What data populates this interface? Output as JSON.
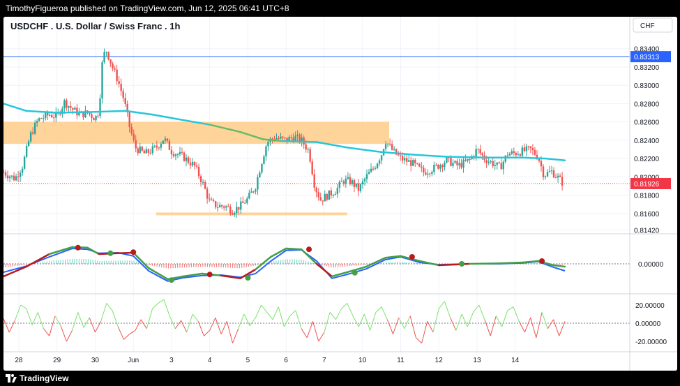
{
  "header": {
    "publisher_text": "TimothyFigueroa published on TradingView.com, Jun 12, 2025 06:41 UTC+8"
  },
  "footer": {
    "brand": "TradingView"
  },
  "chart_data": {
    "type": "candlestick",
    "title": "USDCHF . U.S. Dollar / Swiss Franc . 1h",
    "currency": "CHF",
    "price_axis": {
      "ticks": [
        "0.83400",
        "0.83200",
        "0.83000",
        "0.82800",
        "0.82600",
        "0.82400",
        "0.82200",
        "0.82000",
        "0.81800",
        "0.81600",
        "0.81420"
      ],
      "tick_values": [
        0.834,
        0.832,
        0.83,
        0.828,
        0.826,
        0.824,
        0.822,
        0.82,
        0.818,
        0.816,
        0.8142
      ],
      "range": [
        0.814,
        0.8352
      ]
    },
    "x_axis": {
      "labels": [
        "28",
        "29",
        "30",
        "Jun",
        "3",
        "4",
        "5",
        "6",
        "7",
        "10",
        "11",
        "12",
        "13",
        "14"
      ],
      "range": [
        -3.4,
        13
      ]
    },
    "horizontal_line": {
      "price": 0.83313,
      "label": "0.83313",
      "color": "#2962ff"
    },
    "last_price": {
      "price": 0.81926,
      "label": "0.81926",
      "color": "#f23645"
    },
    "zones": [
      {
        "from": -3.4,
        "to": 6.7,
        "low": 0.8236,
        "high": 0.826,
        "color": "#ffcc88"
      },
      {
        "from": 0.6,
        "to": 5.6,
        "low": 0.8158,
        "high": 0.8161,
        "color": "#ffcc88"
      }
    ],
    "price_path": [
      {
        "x": -3.4,
        "y": 0.8205
      },
      {
        "x": -3.1,
        "y": 0.8198
      },
      {
        "x": -2.9,
        "y": 0.8212
      },
      {
        "x": -2.7,
        "y": 0.8245
      },
      {
        "x": -2.5,
        "y": 0.8262
      },
      {
        "x": -2.2,
        "y": 0.8268
      },
      {
        "x": -2.0,
        "y": 0.8266
      },
      {
        "x": -1.8,
        "y": 0.8282
      },
      {
        "x": -1.6,
        "y": 0.8274
      },
      {
        "x": -1.4,
        "y": 0.8268
      },
      {
        "x": -1.2,
        "y": 0.827
      },
      {
        "x": -1.0,
        "y": 0.8264
      },
      {
        "x": -0.9,
        "y": 0.8272
      },
      {
        "x": -0.8,
        "y": 0.8332
      },
      {
        "x": -0.7,
        "y": 0.8338
      },
      {
        "x": -0.55,
        "y": 0.832
      },
      {
        "x": -0.4,
        "y": 0.8305
      },
      {
        "x": -0.25,
        "y": 0.8285
      },
      {
        "x": -0.1,
        "y": 0.8255
      },
      {
        "x": 0.05,
        "y": 0.8232
      },
      {
        "x": 0.3,
        "y": 0.8225
      },
      {
        "x": 0.6,
        "y": 0.8232
      },
      {
        "x": 0.8,
        "y": 0.8242
      },
      {
        "x": 1.0,
        "y": 0.8228
      },
      {
        "x": 1.3,
        "y": 0.8222
      },
      {
        "x": 1.6,
        "y": 0.8212
      },
      {
        "x": 1.8,
        "y": 0.8195
      },
      {
        "x": 2.0,
        "y": 0.8172
      },
      {
        "x": 2.2,
        "y": 0.8168
      },
      {
        "x": 2.4,
        "y": 0.8168
      },
      {
        "x": 2.6,
        "y": 0.8163
      },
      {
        "x": 2.8,
        "y": 0.8168
      },
      {
        "x": 3.0,
        "y": 0.8176
      },
      {
        "x": 3.2,
        "y": 0.819
      },
      {
        "x": 3.35,
        "y": 0.8215
      },
      {
        "x": 3.5,
        "y": 0.8238
      },
      {
        "x": 3.7,
        "y": 0.8243
      },
      {
        "x": 4.0,
        "y": 0.824
      },
      {
        "x": 4.2,
        "y": 0.8244
      },
      {
        "x": 4.4,
        "y": 0.824
      },
      {
        "x": 4.6,
        "y": 0.8228
      },
      {
        "x": 4.75,
        "y": 0.819
      },
      {
        "x": 4.9,
        "y": 0.8175
      },
      {
        "x": 5.1,
        "y": 0.818
      },
      {
        "x": 5.3,
        "y": 0.8185
      },
      {
        "x": 5.5,
        "y": 0.8196
      },
      {
        "x": 5.7,
        "y": 0.8195
      },
      {
        "x": 5.9,
        "y": 0.8186
      },
      {
        "x": 6.1,
        "y": 0.82
      },
      {
        "x": 6.3,
        "y": 0.821
      },
      {
        "x": 6.5,
        "y": 0.8225
      },
      {
        "x": 6.6,
        "y": 0.824
      },
      {
        "x": 6.8,
        "y": 0.8228
      },
      {
        "x": 7.0,
        "y": 0.822
      },
      {
        "x": 7.3,
        "y": 0.8215
      },
      {
        "x": 7.6,
        "y": 0.8205
      },
      {
        "x": 7.9,
        "y": 0.821
      },
      {
        "x": 8.2,
        "y": 0.8218
      },
      {
        "x": 8.5,
        "y": 0.8212
      },
      {
        "x": 8.8,
        "y": 0.8218
      },
      {
        "x": 9.0,
        "y": 0.823
      },
      {
        "x": 9.2,
        "y": 0.822
      },
      {
        "x": 9.4,
        "y": 0.8215
      },
      {
        "x": 9.6,
        "y": 0.821
      },
      {
        "x": 9.8,
        "y": 0.8225
      },
      {
        "x": 10.0,
        "y": 0.8226
      },
      {
        "x": 10.2,
        "y": 0.8228
      },
      {
        "x": 10.4,
        "y": 0.823
      },
      {
        "x": 10.6,
        "y": 0.8222
      },
      {
        "x": 10.75,
        "y": 0.8202
      },
      {
        "x": 10.95,
        "y": 0.8206
      },
      {
        "x": 11.1,
        "y": 0.82
      },
      {
        "x": 11.25,
        "y": 0.8193
      }
    ],
    "moving_average": [
      {
        "x": -3.4,
        "y": 0.828
      },
      {
        "x": -2.8,
        "y": 0.8272
      },
      {
        "x": -2.0,
        "y": 0.827
      },
      {
        "x": -1.0,
        "y": 0.8271
      },
      {
        "x": -0.2,
        "y": 0.8272
      },
      {
        "x": 0.5,
        "y": 0.8268
      },
      {
        "x": 1.3,
        "y": 0.8262
      },
      {
        "x": 2.0,
        "y": 0.8257
      },
      {
        "x": 2.8,
        "y": 0.8249
      },
      {
        "x": 3.4,
        "y": 0.8241
      },
      {
        "x": 3.9,
        "y": 0.8239
      },
      {
        "x": 4.8,
        "y": 0.8238
      },
      {
        "x": 5.6,
        "y": 0.8232
      },
      {
        "x": 6.5,
        "y": 0.8227
      },
      {
        "x": 7.4,
        "y": 0.8224
      },
      {
        "x": 8.2,
        "y": 0.8222
      },
      {
        "x": 9.2,
        "y": 0.8221
      },
      {
        "x": 10.2,
        "y": 0.8221
      },
      {
        "x": 10.8,
        "y": 0.822
      },
      {
        "x": 11.3,
        "y": 0.8218
      }
    ],
    "oscillator_1": {
      "zero_label": "0.00000",
      "range": [
        -1.0,
        1.0
      ],
      "fast_line": [
        {
          "x": -3.4,
          "y": -0.45
        },
        {
          "x": -2.8,
          "y": -0.1
        },
        {
          "x": -2.2,
          "y": 0.35
        },
        {
          "x": -1.6,
          "y": 0.6
        },
        {
          "x": -1.2,
          "y": 0.58
        },
        {
          "x": -0.9,
          "y": 0.35
        },
        {
          "x": -0.4,
          "y": 0.38
        },
        {
          "x": 0.0,
          "y": 0.4
        },
        {
          "x": 0.4,
          "y": -0.15
        },
        {
          "x": 0.9,
          "y": -0.55
        },
        {
          "x": 1.3,
          "y": -0.45
        },
        {
          "x": 1.8,
          "y": -0.35
        },
        {
          "x": 2.3,
          "y": -0.42
        },
        {
          "x": 2.8,
          "y": -0.52
        },
        {
          "x": 3.2,
          "y": -0.2
        },
        {
          "x": 3.6,
          "y": 0.25
        },
        {
          "x": 4.0,
          "y": 0.55
        },
        {
          "x": 4.4,
          "y": 0.52
        },
        {
          "x": 4.8,
          "y": 0.0
        },
        {
          "x": 5.2,
          "y": -0.45
        },
        {
          "x": 5.6,
          "y": -0.3
        },
        {
          "x": 6.1,
          "y": -0.1
        },
        {
          "x": 6.6,
          "y": 0.22
        },
        {
          "x": 7.0,
          "y": 0.28
        },
        {
          "x": 7.5,
          "y": 0.1
        },
        {
          "x": 8.0,
          "y": -0.05
        },
        {
          "x": 8.8,
          "y": 0.0
        },
        {
          "x": 9.6,
          "y": 0.02
        },
        {
          "x": 10.2,
          "y": 0.05
        },
        {
          "x": 10.6,
          "y": 0.1
        },
        {
          "x": 11.0,
          "y": -0.05
        },
        {
          "x": 11.3,
          "y": -0.1
        }
      ],
      "slow_line": [
        {
          "x": -3.4,
          "y": -0.3
        },
        {
          "x": -2.8,
          "y": -0.08
        },
        {
          "x": -2.2,
          "y": 0.25
        },
        {
          "x": -1.6,
          "y": 0.55
        },
        {
          "x": -1.2,
          "y": 0.52
        },
        {
          "x": -0.9,
          "y": 0.38
        },
        {
          "x": -0.4,
          "y": 0.4
        },
        {
          "x": 0.0,
          "y": 0.28
        },
        {
          "x": 0.4,
          "y": -0.25
        },
        {
          "x": 0.9,
          "y": -0.62
        },
        {
          "x": 1.3,
          "y": -0.5
        },
        {
          "x": 1.8,
          "y": -0.42
        },
        {
          "x": 2.3,
          "y": -0.4
        },
        {
          "x": 2.8,
          "y": -0.48
        },
        {
          "x": 3.2,
          "y": -0.35
        },
        {
          "x": 3.6,
          "y": 0.1
        },
        {
          "x": 4.0,
          "y": 0.48
        },
        {
          "x": 4.4,
          "y": 0.5
        },
        {
          "x": 4.8,
          "y": 0.1
        },
        {
          "x": 5.2,
          "y": -0.52
        },
        {
          "x": 5.6,
          "y": -0.38
        },
        {
          "x": 6.1,
          "y": -0.18
        },
        {
          "x": 6.6,
          "y": 0.15
        },
        {
          "x": 7.0,
          "y": 0.25
        },
        {
          "x": 7.5,
          "y": 0.05
        },
        {
          "x": 8.0,
          "y": -0.03
        },
        {
          "x": 8.8,
          "y": 0.0
        },
        {
          "x": 9.6,
          "y": 0.0
        },
        {
          "x": 10.2,
          "y": 0.03
        },
        {
          "x": 10.6,
          "y": 0.08
        },
        {
          "x": 11.0,
          "y": -0.12
        },
        {
          "x": 11.3,
          "y": -0.25
        }
      ],
      "cross_points": [
        {
          "x": -1.45,
          "y": 0.58,
          "color": "#b71c1c"
        },
        {
          "x": -0.6,
          "y": 0.38,
          "color": "#43a047"
        },
        {
          "x": 0.0,
          "y": 0.42,
          "color": "#b71c1c"
        },
        {
          "x": 1.0,
          "y": -0.58,
          "color": "#43a047"
        },
        {
          "x": 2.0,
          "y": -0.38,
          "color": "#b71c1c"
        },
        {
          "x": 3.0,
          "y": -0.5,
          "color": "#43a047"
        },
        {
          "x": 4.6,
          "y": 0.52,
          "color": "#b71c1c"
        },
        {
          "x": 5.8,
          "y": -0.32,
          "color": "#43a047"
        },
        {
          "x": 7.3,
          "y": 0.25,
          "color": "#b71c1c"
        },
        {
          "x": 8.6,
          "y": 0.0,
          "color": "#43a047"
        },
        {
          "x": 10.7,
          "y": 0.1,
          "color": "#b71c1c"
        }
      ]
    },
    "oscillator_2": {
      "ticks": [
        "20.00000",
        "0.00000",
        "-20.00000"
      ],
      "tick_values": [
        20,
        0,
        -20
      ],
      "range": [
        -30,
        30
      ],
      "values": [
        [
          -3.4,
          5
        ],
        [
          -3.25,
          -10
        ],
        [
          -3.1,
          3
        ],
        [
          -2.95,
          20
        ],
        [
          -2.8,
          16
        ],
        [
          -2.65,
          -2
        ],
        [
          -2.5,
          12
        ],
        [
          -2.35,
          -6
        ],
        [
          -2.2,
          -14
        ],
        [
          -2.05,
          8
        ],
        [
          -1.9,
          -3
        ],
        [
          -1.75,
          -20
        ],
        [
          -1.6,
          -8
        ],
        [
          -1.45,
          12
        ],
        [
          -1.3,
          -5
        ],
        [
          -1.15,
          6
        ],
        [
          -1.0,
          -10
        ],
        [
          -0.85,
          2
        ],
        [
          -0.7,
          22
        ],
        [
          -0.55,
          14
        ],
        [
          -0.4,
          -4
        ],
        [
          -0.25,
          -18
        ],
        [
          -0.1,
          -12
        ],
        [
          0.05,
          -8
        ],
        [
          0.2,
          4
        ],
        [
          0.35,
          -6
        ],
        [
          0.5,
          16
        ],
        [
          0.65,
          22
        ],
        [
          0.8,
          26
        ],
        [
          0.95,
          8
        ],
        [
          1.1,
          -6
        ],
        [
          1.25,
          3
        ],
        [
          1.4,
          -10
        ],
        [
          1.55,
          10
        ],
        [
          1.7,
          2
        ],
        [
          1.85,
          -14
        ],
        [
          2.0,
          -8
        ],
        [
          2.15,
          6
        ],
        [
          2.3,
          -12
        ],
        [
          2.45,
          2
        ],
        [
          2.6,
          -22
        ],
        [
          2.75,
          -6
        ],
        [
          2.9,
          10
        ],
        [
          3.05,
          -3
        ],
        [
          3.2,
          6
        ],
        [
          3.35,
          20
        ],
        [
          3.5,
          12
        ],
        [
          3.65,
          4
        ],
        [
          3.8,
          18
        ],
        [
          3.95,
          -4
        ],
        [
          4.1,
          8
        ],
        [
          4.25,
          14
        ],
        [
          4.4,
          -6
        ],
        [
          4.55,
          -16
        ],
        [
          4.7,
          2
        ],
        [
          4.85,
          -20
        ],
        [
          5.0,
          -10
        ],
        [
          5.15,
          12
        ],
        [
          5.3,
          4
        ],
        [
          5.45,
          16
        ],
        [
          5.6,
          22
        ],
        [
          5.75,
          8
        ],
        [
          5.9,
          -4
        ],
        [
          6.05,
          10
        ],
        [
          6.2,
          -8
        ],
        [
          6.35,
          12
        ],
        [
          6.5,
          18
        ],
        [
          6.65,
          4
        ],
        [
          6.8,
          -12
        ],
        [
          6.95,
          6
        ],
        [
          7.1,
          -6
        ],
        [
          7.25,
          8
        ],
        [
          7.4,
          -16
        ],
        [
          7.55,
          -22
        ],
        [
          7.7,
          2
        ],
        [
          7.85,
          -10
        ],
        [
          8.0,
          16
        ],
        [
          8.15,
          24
        ],
        [
          8.3,
          6
        ],
        [
          8.45,
          -8
        ],
        [
          8.6,
          10
        ],
        [
          8.75,
          -4
        ],
        [
          8.9,
          12
        ],
        [
          9.05,
          20
        ],
        [
          9.2,
          4
        ],
        [
          9.35,
          -14
        ],
        [
          9.5,
          8
        ],
        [
          9.65,
          -4
        ],
        [
          9.8,
          14
        ],
        [
          9.95,
          18
        ],
        [
          10.1,
          2
        ],
        [
          10.25,
          -10
        ],
        [
          10.4,
          6
        ],
        [
          10.55,
          -16
        ],
        [
          10.7,
          12
        ],
        [
          10.85,
          -6
        ],
        [
          11.0,
          4
        ],
        [
          11.15,
          -14
        ],
        [
          11.3,
          2
        ]
      ]
    },
    "price_axis_position": "right",
    "grid": true
  }
}
